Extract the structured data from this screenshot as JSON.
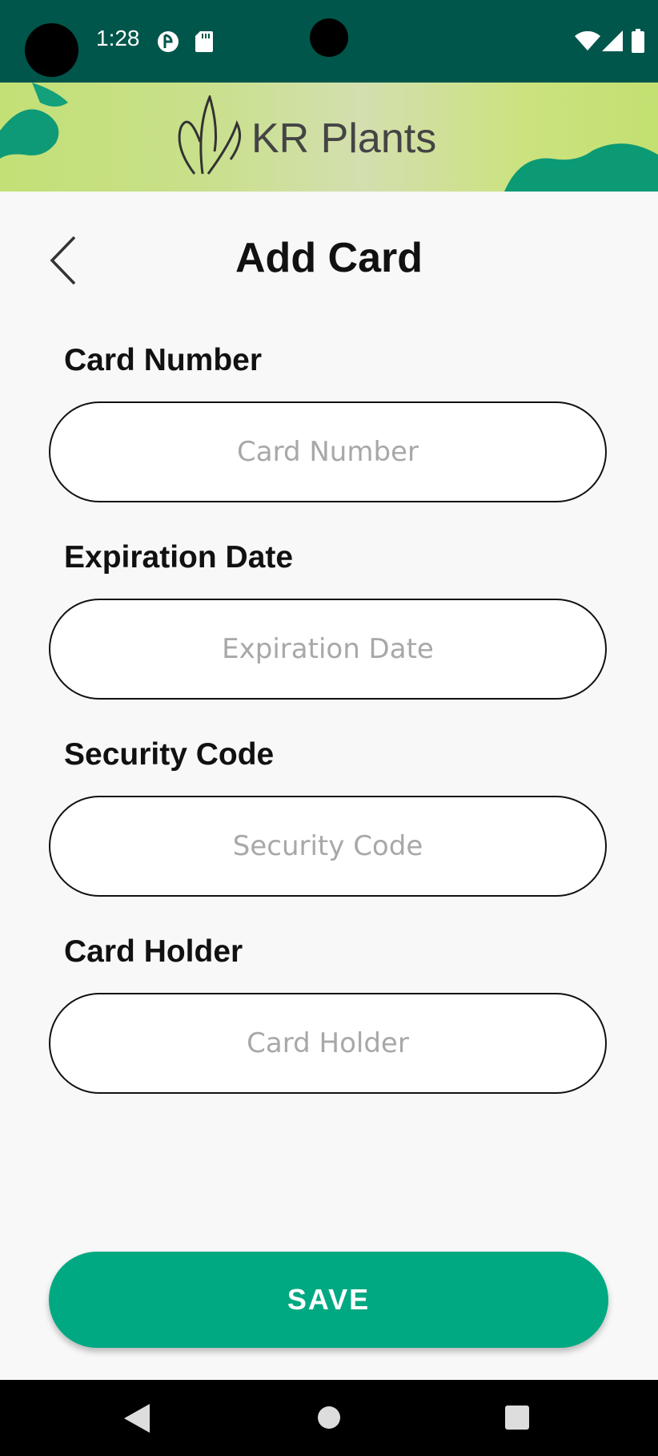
{
  "status_bar": {
    "time": "1:28"
  },
  "brand": {
    "name": "KR Plants"
  },
  "page": {
    "title": "Add Card"
  },
  "form": {
    "fields": [
      {
        "label": "Card Number",
        "placeholder": "Card Number",
        "value": ""
      },
      {
        "label": "Expiration Date",
        "placeholder": "Expiration Date",
        "value": ""
      },
      {
        "label": "Security Code",
        "placeholder": "Security Code",
        "value": ""
      },
      {
        "label": "Card Holder",
        "placeholder": "Card Holder",
        "value": ""
      }
    ],
    "save_label": "SAVE"
  },
  "colors": {
    "status_bar": "#00564b",
    "accent": "#00a982",
    "banner": "#c8e08a"
  },
  "icons": {
    "back": "chevron-left-icon",
    "wifi": "wifi-icon",
    "signal": "signal-icon",
    "battery": "battery-icon",
    "nav_back": "triangle-back-icon",
    "nav_home": "circle-home-icon",
    "nav_recents": "square-recents-icon"
  }
}
